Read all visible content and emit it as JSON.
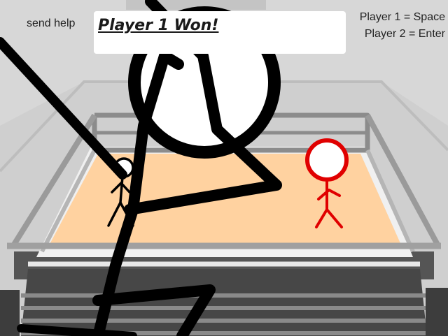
{
  "hud": {
    "send_help": "send help",
    "banner_text": "Player 1  Won!",
    "controls": {
      "player1": "Player 1 = Space",
      "player2": "Player 2 = Enter"
    }
  },
  "colors": {
    "background": "#d9d9d9",
    "back_wall": "#cfcfcf",
    "ring_mat": "#ffd2a0",
    "ring_ropes": "#8c8c8c",
    "ring_base": "#555555",
    "player1": "#000000",
    "player2": "#e00000",
    "banner_bg": "#ffffff"
  },
  "players": [
    {
      "id": "player1",
      "color": "black",
      "state": "winner"
    },
    {
      "id": "player2",
      "color": "red",
      "state": "idle"
    }
  ]
}
